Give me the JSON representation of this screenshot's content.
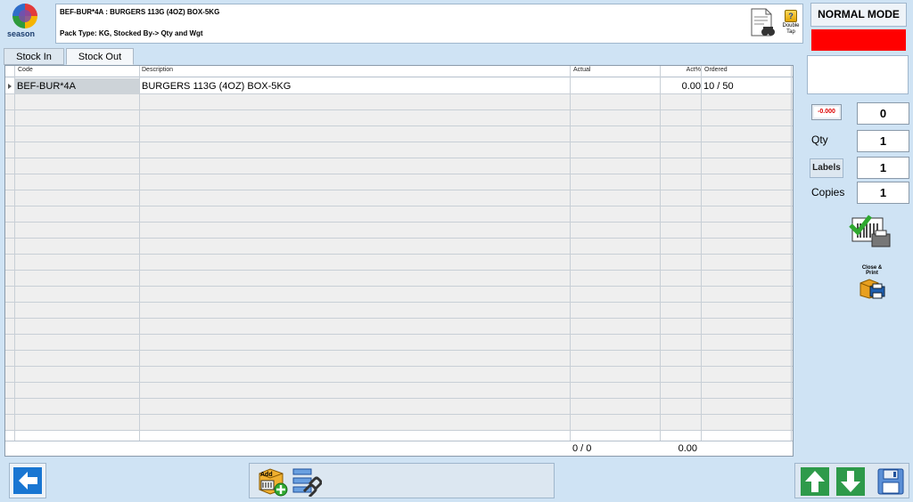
{
  "logo": {
    "text": "season"
  },
  "header": {
    "product_line": "BEF-BUR*4A : BURGERS 113G (4OZ) BOX-5KG",
    "pack_line": "Pack Type: KG,   Stocked By-> Qty and Wgt",
    "double_tap_label": "Double Tap",
    "help_glyph": "?"
  },
  "mode": {
    "label": "NORMAL MODE",
    "status_color": "#ff0000"
  },
  "tabs": [
    {
      "label": "Stock In"
    },
    {
      "label": "Stock Out",
      "active": true
    }
  ],
  "grid": {
    "headers": {
      "code": "Code",
      "description": "Description",
      "actual": "Actual",
      "act_pct": "Act%",
      "ordered": "Ordered"
    },
    "rows": [
      {
        "code": "BEF-BUR*4A",
        "description": "BURGERS 113G (4OZ) BOX-5KG",
        "actual": "",
        "act_pct": "0.00",
        "ordered": "10 / 50"
      }
    ],
    "footer": {
      "actual": "0 / 0",
      "act_pct": "0.00"
    }
  },
  "side": {
    "neg_button": "-0.000",
    "weight_value": "0",
    "qty_label": "Qty",
    "qty_value": "1",
    "labels_button": "Labels",
    "labels_value": "1",
    "copies_label": "Copies",
    "copies_value": "1",
    "close_print_label": "Close & Print"
  },
  "bottom": {
    "add_label": "Add"
  },
  "icons": {
    "back": "back-arrow-icon",
    "up": "arrow-up-icon",
    "down": "arrow-down-icon",
    "save": "floppy-save-icon"
  }
}
